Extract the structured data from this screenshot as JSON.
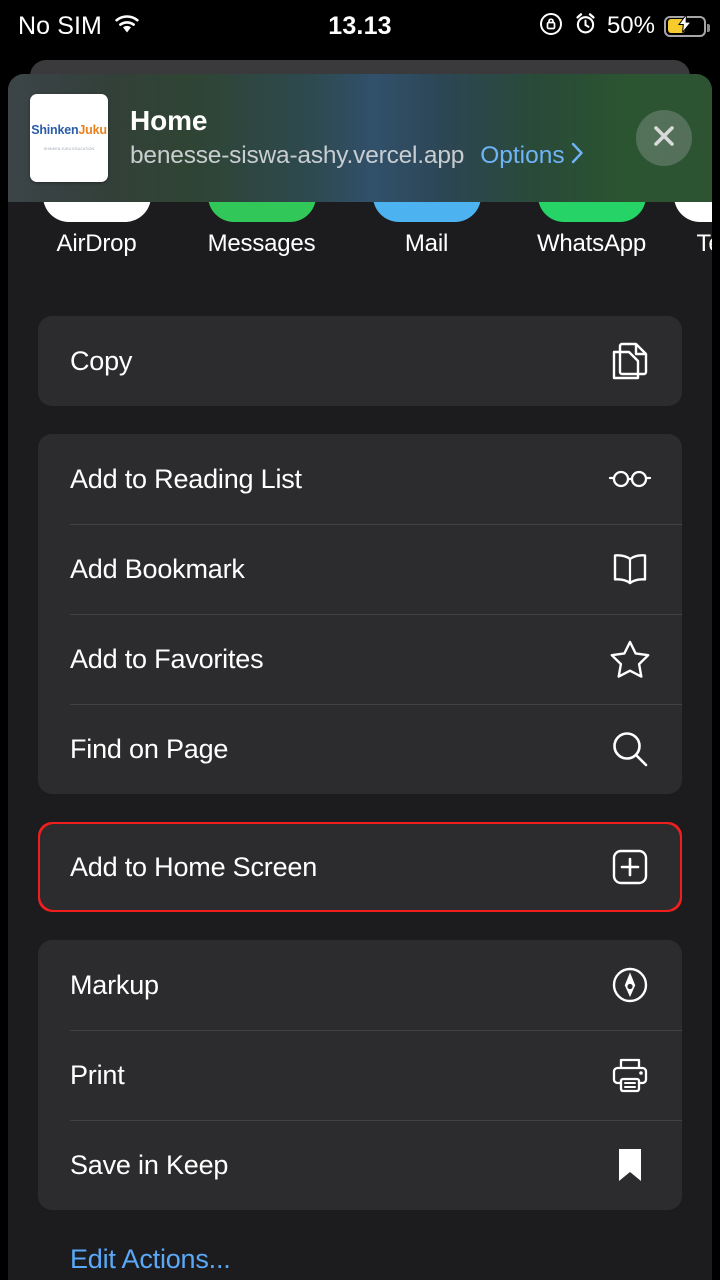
{
  "status_bar": {
    "carrier": "No SIM",
    "wifi_icon": "wifi-icon",
    "time": "13.13",
    "rotation_lock_icon": "rotation-lock-icon",
    "alarm_icon": "alarm-clock-icon",
    "battery_percent": "50%",
    "battery_icon": "battery-charging-icon",
    "battery_level": 50,
    "battery_color": "#f5cb2e"
  },
  "share_sheet": {
    "header": {
      "app_icon_name": "site-favicon",
      "logo_main_a": "Shinken",
      "logo_main_b": "Juku",
      "logo_sub": "SHINKEN JUKU EDUCATION",
      "title": "Home",
      "url": "benesse-siswa-ashy.vercel.app",
      "options_label": "Options",
      "options_chevron": "chevron-right-icon",
      "close_icon": "close-icon"
    },
    "apps": [
      {
        "label": "AirDrop",
        "color": "#ffffff",
        "icon": "airdrop-icon"
      },
      {
        "label": "Messages",
        "color": "#32c759",
        "icon": "messages-icon"
      },
      {
        "label": "Mail",
        "color": "#4db2f0",
        "icon": "mail-icon"
      },
      {
        "label": "WhatsApp",
        "color": "#25d366",
        "icon": "whatsapp-icon"
      },
      {
        "label": "Te",
        "color": "#ffffff",
        "icon": "telegram-icon"
      }
    ],
    "groups": [
      {
        "name": "copy-group",
        "rows": [
          {
            "label": "Copy",
            "icon": "copy-documents-icon"
          }
        ]
      },
      {
        "name": "browser-actions-group",
        "rows": [
          {
            "label": "Add to Reading List",
            "icon": "glasses-icon"
          },
          {
            "label": "Add Bookmark",
            "icon": "open-book-icon"
          },
          {
            "label": "Add to Favorites",
            "icon": "star-icon"
          },
          {
            "label": "Find on Page",
            "icon": "magnifier-icon"
          }
        ]
      },
      {
        "name": "home-screen-group",
        "highlighted": true,
        "highlight_color": "#f01e1e",
        "rows": [
          {
            "label": "Add to Home Screen",
            "icon": "plus-square-icon"
          }
        ]
      },
      {
        "name": "tools-group",
        "rows": [
          {
            "label": "Markup",
            "icon": "markup-pen-icon"
          },
          {
            "label": "Print",
            "icon": "printer-icon"
          },
          {
            "label": "Save in Keep",
            "icon": "bookmark-filled-icon"
          }
        ]
      }
    ],
    "edit_actions_label": "Edit Actions..."
  }
}
